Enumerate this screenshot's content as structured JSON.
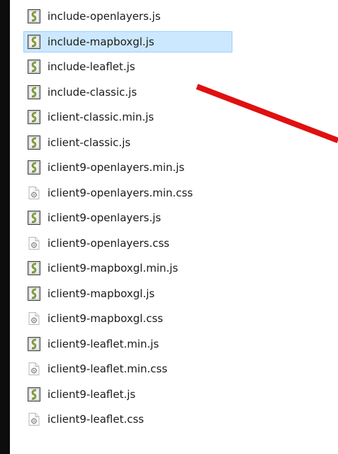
{
  "files": [
    {
      "name": "include-openlayers.js",
      "type": "js",
      "icon": "script-file-icon"
    },
    {
      "name": "include-mapboxgl.js",
      "type": "js",
      "icon": "script-file-icon",
      "selected": true
    },
    {
      "name": "include-leaflet.js",
      "type": "js",
      "icon": "script-file-icon"
    },
    {
      "name": "include-classic.js",
      "type": "js",
      "icon": "script-file-icon"
    },
    {
      "name": "iclient-classic.min.js",
      "type": "js",
      "icon": "script-file-icon"
    },
    {
      "name": "iclient-classic.js",
      "type": "js",
      "icon": "script-file-icon"
    },
    {
      "name": "iclient9-openlayers.min.js",
      "type": "js",
      "icon": "script-file-icon"
    },
    {
      "name": "iclient9-openlayers.min.css",
      "type": "css",
      "icon": "css-file-icon"
    },
    {
      "name": "iclient9-openlayers.js",
      "type": "js",
      "icon": "script-file-icon"
    },
    {
      "name": "iclient9-openlayers.css",
      "type": "css",
      "icon": "css-file-icon"
    },
    {
      "name": "iclient9-mapboxgl.min.js",
      "type": "js",
      "icon": "script-file-icon"
    },
    {
      "name": "iclient9-mapboxgl.js",
      "type": "js",
      "icon": "script-file-icon"
    },
    {
      "name": "iclient9-mapboxgl.css",
      "type": "css",
      "icon": "css-file-icon"
    },
    {
      "name": "iclient9-leaflet.min.js",
      "type": "js",
      "icon": "script-file-icon"
    },
    {
      "name": "iclient9-leaflet.min.css",
      "type": "css",
      "icon": "css-file-icon"
    },
    {
      "name": "iclient9-leaflet.js",
      "type": "js",
      "icon": "script-file-icon"
    },
    {
      "name": "iclient9-leaflet.css",
      "type": "css",
      "icon": "css-file-icon"
    }
  ],
  "colors": {
    "selection_bg": "#cce8ff",
    "selection_border": "#99d1ff",
    "annotation_arrow": "#e01010"
  }
}
